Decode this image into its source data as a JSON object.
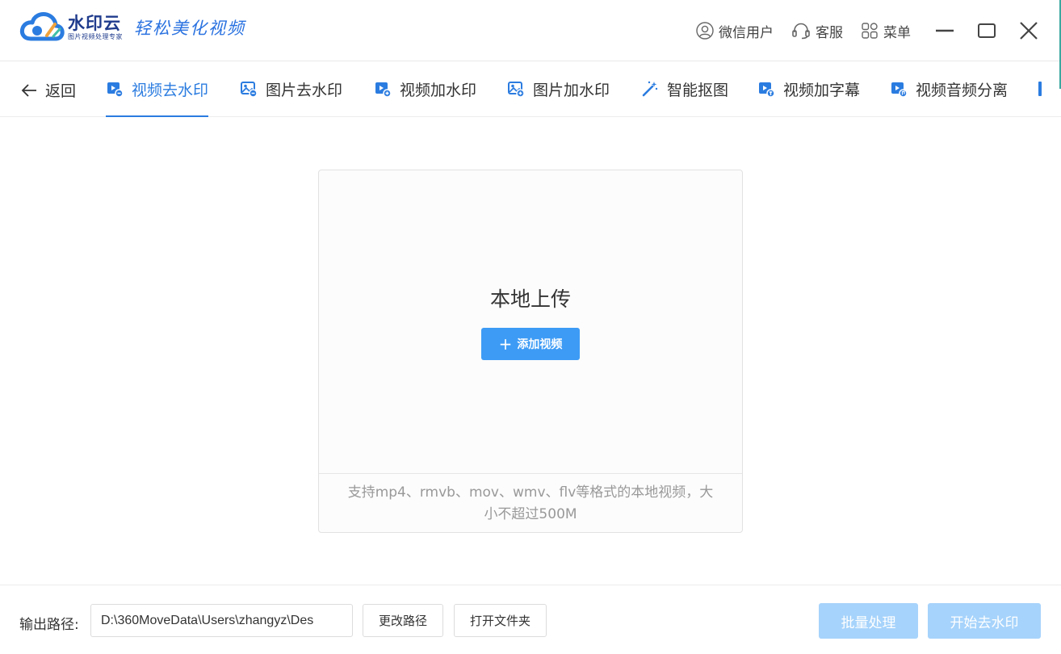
{
  "app": {
    "name": "水印云",
    "subtitle": "图片视频处理专家",
    "slogan": "轻松美化视频"
  },
  "title_actions": {
    "user_label": "微信用户",
    "service_label": "客服",
    "menu_label": "菜单",
    "user_icon": "user-circle-icon",
    "service_icon": "headset-icon",
    "menu_icon": "grid-menu-icon"
  },
  "window_controls": [
    "minimize",
    "maximize",
    "close"
  ],
  "nav": {
    "back_label": "返回",
    "items": [
      {
        "label": "视频去水印",
        "icon": "video-remove-icon",
        "active": true
      },
      {
        "label": "图片去水印",
        "icon": "image-remove-icon",
        "active": false
      },
      {
        "label": "视频加水印",
        "icon": "video-add-icon",
        "active": false
      },
      {
        "label": "图片加水印",
        "icon": "image-add-icon",
        "active": false
      },
      {
        "label": "智能抠图",
        "icon": "magic-wand-icon",
        "active": false
      },
      {
        "label": "视频加字幕",
        "icon": "video-subtitle-icon",
        "active": false
      },
      {
        "label": "视频音频分离",
        "icon": "video-audio-icon",
        "active": false
      }
    ]
  },
  "upload": {
    "title": "本地上传",
    "add_button_label": "添加视频",
    "hint": "支持mp4、rmvb、mov、wmv、flv等格式的本地视频，大小不超过500M"
  },
  "bottom": {
    "output_label": "输出路径:",
    "output_path": "D:\\360MoveData\\Users\\zhangyz\\Des",
    "change_path_label": "更改路径",
    "open_folder_label": "打开文件夹",
    "batch_label": "批量处理",
    "start_label": "开始去水印"
  },
  "colors": {
    "accent": "#2b7ce0",
    "primary_button": "#3d9bf5",
    "disabled_button": "#a6d3fb"
  }
}
